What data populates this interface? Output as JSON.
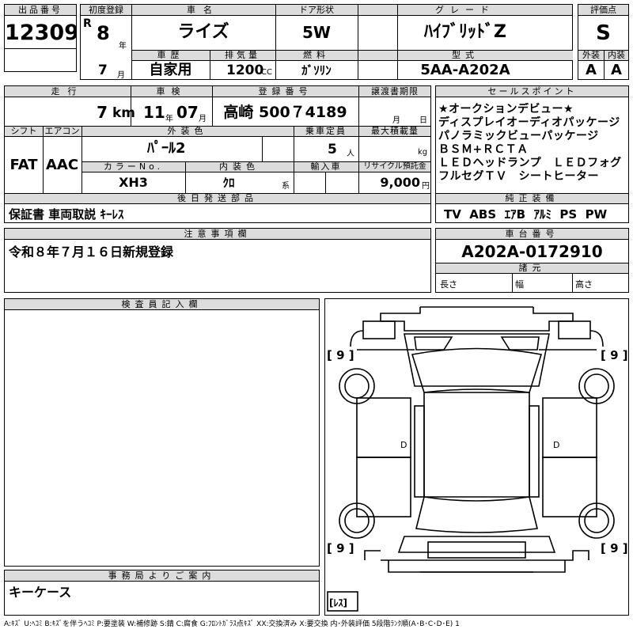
{
  "header": {
    "lot_no_label": "出品番号",
    "lot_no": "12309",
    "first_reg_label": "初度登録",
    "era": "R",
    "first_reg_year": "8",
    "year_unit": "年",
    "first_reg_month": "7",
    "month_unit": "月",
    "car_name_label": "車名",
    "car_name": "ライズ",
    "door_label": "ドア形状",
    "door": "5W",
    "grade_label": "グレード",
    "grade": "ﾊｲﾌﾞﾘｯﾄﾞZ",
    "score_label": "評価点",
    "score": "S",
    "history_label": "車歴",
    "history": "自家用",
    "displacement_label": "排気量",
    "displacement": "1200",
    "displacement_unit": "CC",
    "fuel_label": "燃料",
    "fuel": "ｶﾞｿﾘﾝ",
    "model_label": "型式",
    "model": "5AA-A202A",
    "exterior_label": "外装",
    "exterior": "A",
    "interior_label": "内装",
    "interior": "A"
  },
  "row2": {
    "mileage_label": "走行",
    "mileage": "7",
    "mileage_unit": "km",
    "inspection_label": "車検",
    "inspection_year": "11",
    "inspection_month": "07",
    "year_unit": "年",
    "month_unit": "月",
    "plate_label": "登録番号",
    "plate": "高崎 500７4189",
    "transfer_label": "譲渡書期限",
    "transfer_month_unit": "月",
    "transfer_day_unit": "日",
    "shift_label": "シフト",
    "shift": "FAT",
    "ac_label": "エアコン",
    "ac": "AAC",
    "color_label": "外装色",
    "color": "ﾊﾟｰﾙ2",
    "capacity_label": "乗車定員",
    "capacity": "5",
    "capacity_unit": "人",
    "load_label": "最大積載量",
    "load_unit": "kg",
    "color_no_label": "カラーNo.",
    "color_no": "XH3",
    "int_color_label": "内装色",
    "int_color": "ｸﾛ",
    "int_color_suffix": "系",
    "import_label": "輸入車",
    "recycle_label": "リサイクル預託金",
    "recycle": "9,000",
    "recycle_unit": "円",
    "later_parts_label": "後日発送部品",
    "later_parts": "保証書 車両取説 ｷｰﾚｽ"
  },
  "sales_points": {
    "label": "セールスポイント",
    "items": [
      "★オークションデビュー★",
      "ディスプレイオーディオパッケージ",
      "パノラミックビューパッケージ",
      "ＢＳＭ+ＲＣＴＡ",
      "ＬＥＤヘッドランプ　ＬＥＤフォグ",
      "フルセグＴＶ　シートヒーター"
    ]
  },
  "equipment": {
    "label": "純正装備",
    "value": "TV  ABS  ｴｱB  ｱﾙﾐ  PS  PW"
  },
  "notes": {
    "label": "注意事項欄",
    "value": "令和８年７月１６日新規登録"
  },
  "chassis": {
    "label": "車台番号",
    "value": "A202A-0172910",
    "specs_label": "諸元",
    "length_label": "長さ",
    "width_label": "幅",
    "height_label": "高さ"
  },
  "inspector": {
    "label": "検査員記入欄"
  },
  "diagram": {
    "tire_front_left": "[ 9 ]",
    "tire_front_right": "[ 9 ]",
    "tire_rear_left": "[ 9 ]",
    "tire_rear_right": "[ 9 ]",
    "spare": "[ﾚｽ]",
    "d_left": "D",
    "d_right": "D"
  },
  "office": {
    "label": "事務局よりご案内",
    "value": "キーケース"
  },
  "legend": "A:ｷｽﾞ U:ﾍｺﾐ B:ｷｽﾞを伴うﾍｺﾐ P:要塗装 W:補修跡 S:錆 C:腐食 G:ﾌﾛﾝﾄｶﾞﾗｽ点ｷｽﾞ XX:交換済み X:要交換 内･外装評価 5段階ﾗﾝｸ順(A･B･C･D･E) 1"
}
